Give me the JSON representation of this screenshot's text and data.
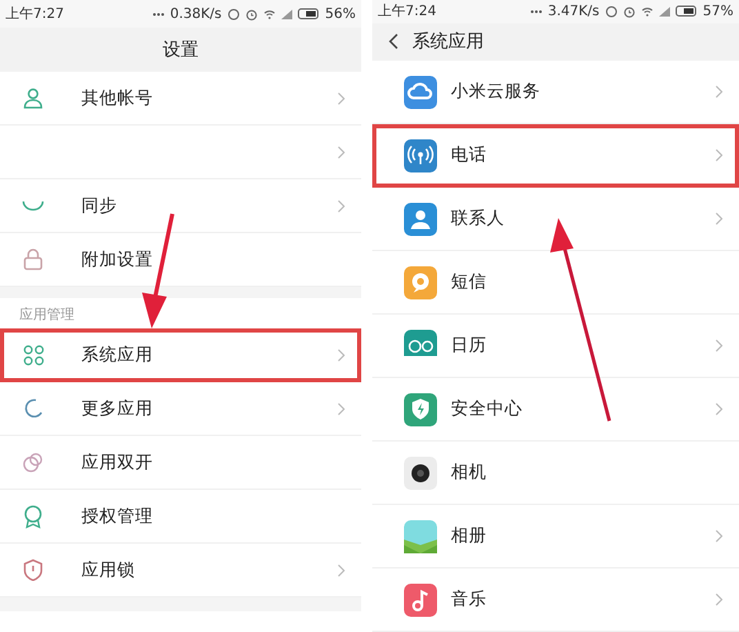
{
  "panels": [
    {
      "status": {
        "time": "上午7:27",
        "speed": "0.38K/s",
        "battery": "56%"
      },
      "header": {
        "title": "设置",
        "back": false
      },
      "items": [
        {
          "kind": "row",
          "label": "其他帐号",
          "chevron": true,
          "highlighted": false
        },
        {
          "kind": "row",
          "chevron": true,
          "highlighted": false
        },
        {
          "kind": "row",
          "label": "同步",
          "chevron": true,
          "highlighted": false
        },
        {
          "kind": "row",
          "label": "附加设置",
          "chevron": false,
          "highlighted": false
        },
        {
          "kind": "section",
          "label": "应用管理"
        },
        {
          "kind": "row",
          "label": "系统应用",
          "chevron": true,
          "highlighted": true
        },
        {
          "kind": "row",
          "label": "更多应用",
          "chevron": true,
          "highlighted": false
        },
        {
          "kind": "row",
          "label": "应用双开",
          "chevron": false,
          "highlighted": false
        },
        {
          "kind": "row",
          "label": "授权管理",
          "chevron": false,
          "highlighted": false
        },
        {
          "kind": "row",
          "label": "应用锁",
          "chevron": true,
          "highlighted": false
        },
        {
          "kind": "gap"
        }
      ]
    },
    {
      "status": {
        "time": "上午7:24",
        "speed": "3.47K/s",
        "battery": "57%"
      },
      "header": {
        "title": "系统应用",
        "back": true
      },
      "items": [
        {
          "kind": "row",
          "label": "小米云服务",
          "chevron": true,
          "highlighted": false
        },
        {
          "kind": "row",
          "label": "电话",
          "chevron": true,
          "highlighted": true
        },
        {
          "kind": "row",
          "label": "联系人",
          "chevron": true,
          "highlighted": false
        },
        {
          "kind": "row",
          "label": "短信",
          "chevron": false,
          "highlighted": false
        },
        {
          "kind": "row",
          "label": "日历",
          "chevron": true,
          "highlighted": false
        },
        {
          "kind": "row",
          "label": "安全中心",
          "chevron": true,
          "highlighted": false
        },
        {
          "kind": "row",
          "label": "相机",
          "chevron": false,
          "highlighted": false
        },
        {
          "kind": "row",
          "label": "相册",
          "chevron": true,
          "highlighted": false
        },
        {
          "kind": "row",
          "label": "音乐",
          "chevron": true,
          "highlighted": false
        }
      ]
    }
  ]
}
